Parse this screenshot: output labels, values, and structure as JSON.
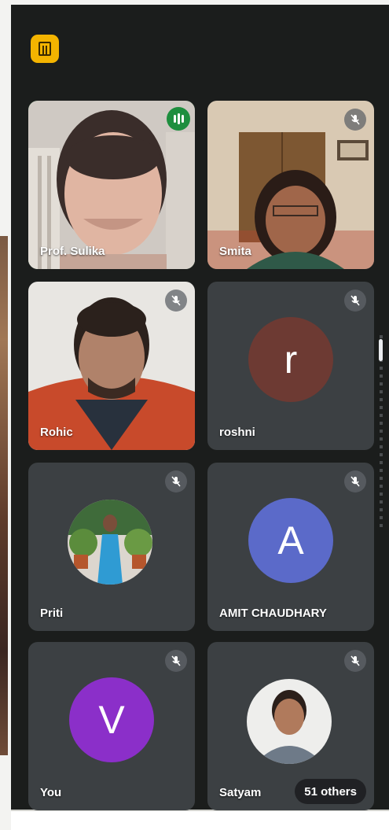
{
  "colors": {
    "background": "#1b1d1c",
    "tile": "#3c4043",
    "speaking_border": "#1e8e3e",
    "room_icon": "#f4b400"
  },
  "header": {
    "room_icon": "room-icon"
  },
  "participants": [
    {
      "name": "Prof. Sulika",
      "type": "video",
      "speaking": true
    },
    {
      "name": "Smita",
      "type": "video",
      "muted": true
    },
    {
      "name": "Rohic",
      "type": "video",
      "muted": true
    },
    {
      "name": "roshni",
      "type": "letter",
      "initial": "r",
      "avatar_color": "#6d3a33",
      "muted": true
    },
    {
      "name": "Priti",
      "type": "photo",
      "muted": true
    },
    {
      "name": "AMIT CHAUDHARY",
      "type": "letter",
      "initial": "A",
      "avatar_color": "#5b6ac9",
      "muted": true
    },
    {
      "name": "You",
      "type": "letter",
      "initial": "V",
      "avatar_color": "#8b2fc9",
      "muted": true
    },
    {
      "name": "Satyam",
      "type": "photo",
      "muted": true
    }
  ],
  "others_count_label": "51 others"
}
